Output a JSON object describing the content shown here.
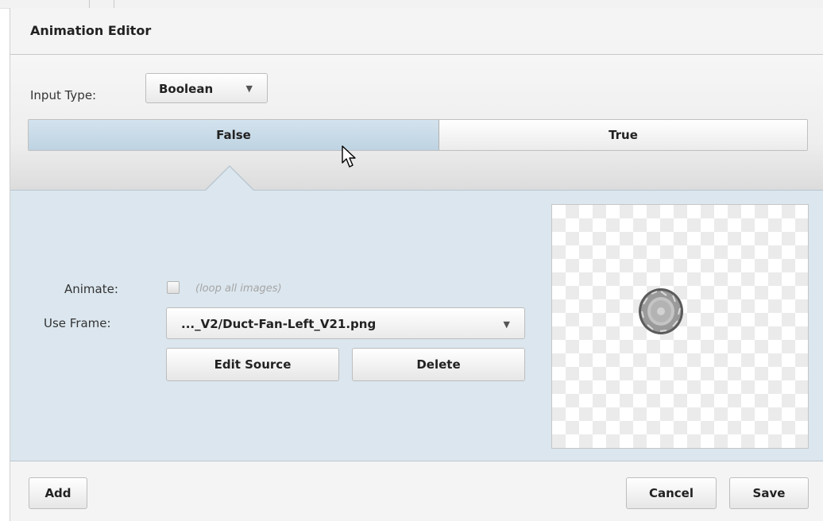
{
  "dialog": {
    "title": "Animation Editor"
  },
  "input_type": {
    "label": "Input Type:",
    "value": "Boolean"
  },
  "tabs": [
    {
      "label": "False",
      "selected": true
    },
    {
      "label": "True",
      "selected": false
    }
  ],
  "animate": {
    "label": "Animate:",
    "checked": false,
    "hint": "(loop all images)"
  },
  "use_frame": {
    "label": "Use Frame:",
    "value": "..._V2/Duct-Fan-Left_V21.png"
  },
  "buttons": {
    "edit_source": "Edit Source",
    "delete": "Delete",
    "add": "Add",
    "cancel": "Cancel",
    "save": "Save"
  },
  "colors": {
    "selected_tab": "#c9dbe8",
    "panel_background": "#dbe6ee"
  },
  "icons": {
    "dropdown": "chevron-down-icon",
    "cursor": "mouse-pointer-icon",
    "preview_image": "duct-fan-image"
  }
}
